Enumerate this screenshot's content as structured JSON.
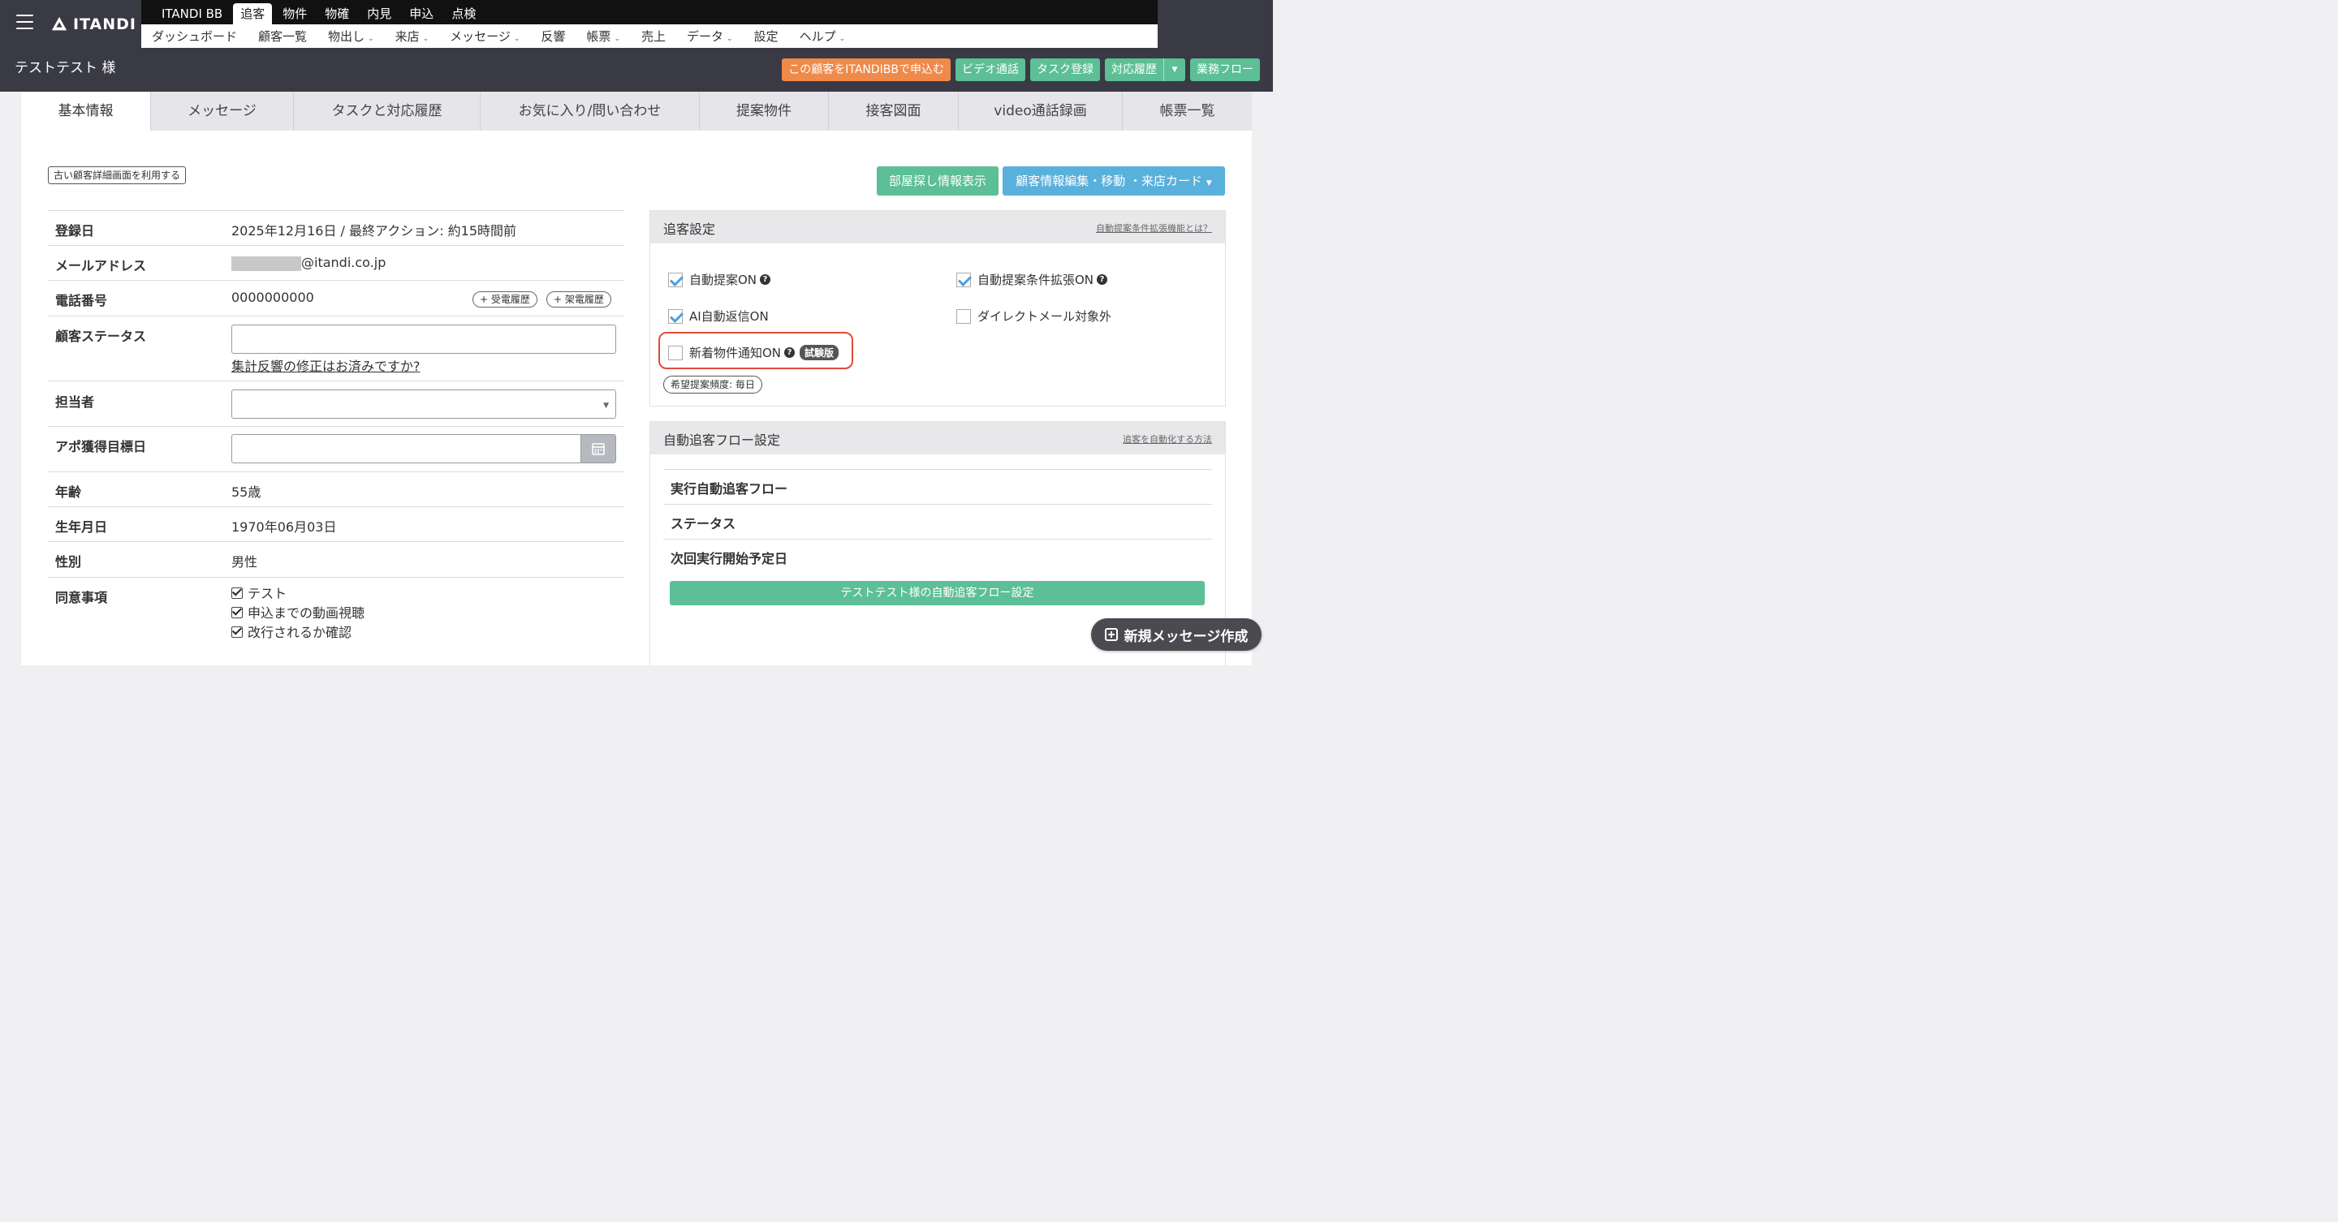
{
  "header": {
    "logo_text": "ITANDI",
    "main_nav": [
      "ITANDI BB",
      "追客",
      "物件",
      "物確",
      "内見",
      "申込",
      "点検"
    ],
    "active_main": "追客",
    "sub_nav": [
      {
        "label": "ダッシュボード",
        "dropdown": false
      },
      {
        "label": "顧客一覧",
        "dropdown": false
      },
      {
        "label": "物出し",
        "dropdown": true
      },
      {
        "label": "来店",
        "dropdown": true
      },
      {
        "label": "メッセージ",
        "dropdown": true
      },
      {
        "label": "反響",
        "dropdown": false
      },
      {
        "label": "帳票",
        "dropdown": true
      },
      {
        "label": "売上",
        "dropdown": false
      },
      {
        "label": "データ",
        "dropdown": true
      },
      {
        "label": "設定",
        "dropdown": false
      },
      {
        "label": "ヘルプ",
        "dropdown": true
      }
    ]
  },
  "titlebar": {
    "customer_name": "テストテスト 様",
    "apply_bb": "この顧客をITANDIBBで申込む",
    "video_call": "ビデオ通話",
    "task_register": "タスク登録",
    "history": "対応履歴",
    "workflow": "業務フロー"
  },
  "tabs": [
    "基本情報",
    "メッセージ",
    "タスクと対応履歴",
    "お気に入り/問い合わせ",
    "提案物件",
    "接客図面",
    "video通話録画",
    "帳票一覧"
  ],
  "active_tab": "基本情報",
  "buttons": {
    "old_detail": "古い顧客詳細画面を利用する",
    "room_search": "部屋探し情報表示",
    "edit": "顧客情報編集・移動 ・来店カード"
  },
  "info": {
    "registered": {
      "label": "登録日",
      "value": "2025年12月16日 / 最終アクション: 約15時間前"
    },
    "email": {
      "label": "メールアドレス",
      "value": "@itandi.co.jp"
    },
    "phone": {
      "label": "電話番号",
      "value": "0000000000",
      "incoming": "+ 受電履歴",
      "outgoing": "+ 架電履歴"
    },
    "status": {
      "label": "顧客ステータス",
      "link": "集計反響の修正はお済みですか?"
    },
    "assignee": {
      "label": "担当者"
    },
    "appointment": {
      "label": "アポ獲得目標日"
    },
    "age": {
      "label": "年齢",
      "value": "55歳"
    },
    "birthday": {
      "label": "生年月日",
      "value": "1970年06月03日"
    },
    "gender": {
      "label": "性別",
      "value": "男性"
    },
    "consent": {
      "label": "同意事項",
      "items": [
        "テスト",
        "申込までの動画視聴",
        "改行されるか確認"
      ]
    }
  },
  "pursuit": {
    "title": "追客設定",
    "help_link": "自動提案条件拡張機能とは？",
    "auto_proposal": {
      "label": "自動提案ON",
      "checked": true
    },
    "auto_proposal_ext": {
      "label": "自動提案条件拡張ON",
      "checked": true
    },
    "ai_reply": {
      "label": "AI自動返信ON",
      "checked": true
    },
    "dm_exclude": {
      "label": "ダイレクトメール対象外",
      "checked": false
    },
    "new_property": {
      "label": "新着物件通知ON",
      "checked": false,
      "badge": "試験版"
    },
    "frequency": "希望提案頻度: 毎日",
    "highlight_color": "#e04b3a"
  },
  "flow": {
    "title": "自動追客フロー設定",
    "help_link": "追客を自動化する方法",
    "rows": [
      "実行自動追客フロー",
      "ステータス",
      "次回実行開始予定日"
    ],
    "button": "テストテスト様の自動追客フロー設定"
  },
  "floating": {
    "new_message": "新規メッセージ作成"
  },
  "colors": {
    "accent_green": "#5cbf96",
    "accent_blue": "#5ab0dc",
    "accent_orange": "#ef8a4a",
    "header_bg": "#3a3a44"
  }
}
